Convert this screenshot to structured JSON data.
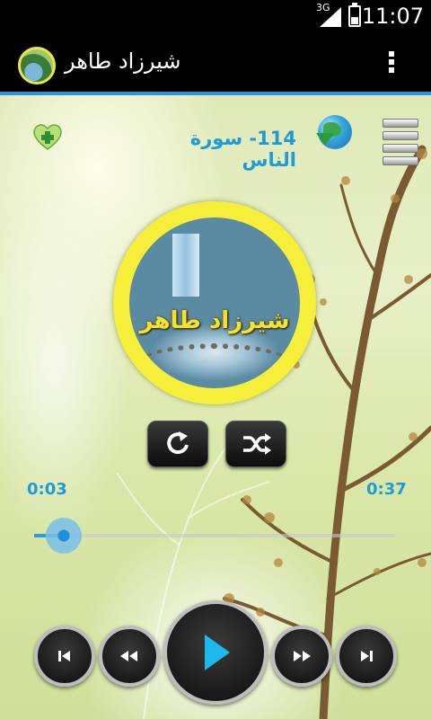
{
  "status_bar": {
    "network": "3G",
    "time": "11:07"
  },
  "action_bar": {
    "title": "شيرزاد طاهر",
    "app_icon": "waterfall-avatar-icon",
    "overflow_icon": "more-vertical-icon"
  },
  "player": {
    "track_title": "114- سورة الناس",
    "artwork_caption": "شيرزاد طاهر",
    "current_time": "0:03",
    "total_time": "0:37",
    "progress_fraction": 0.083,
    "icons": {
      "favorite": "heart-plus-icon",
      "download": "globe-download-icon",
      "playlist": "list-icon",
      "repeat": "repeat-icon",
      "shuffle": "shuffle-icon",
      "previous": "skip-previous-icon",
      "rewind": "rewind-icon",
      "play": "play-icon",
      "forward": "fast-forward-icon",
      "next": "skip-next-icon"
    }
  },
  "colors": {
    "accent": "#2e95d6",
    "title_text": "#1e9bd6",
    "art_ring": "#f5ef3a",
    "play_icon": "#1fb8ec"
  }
}
